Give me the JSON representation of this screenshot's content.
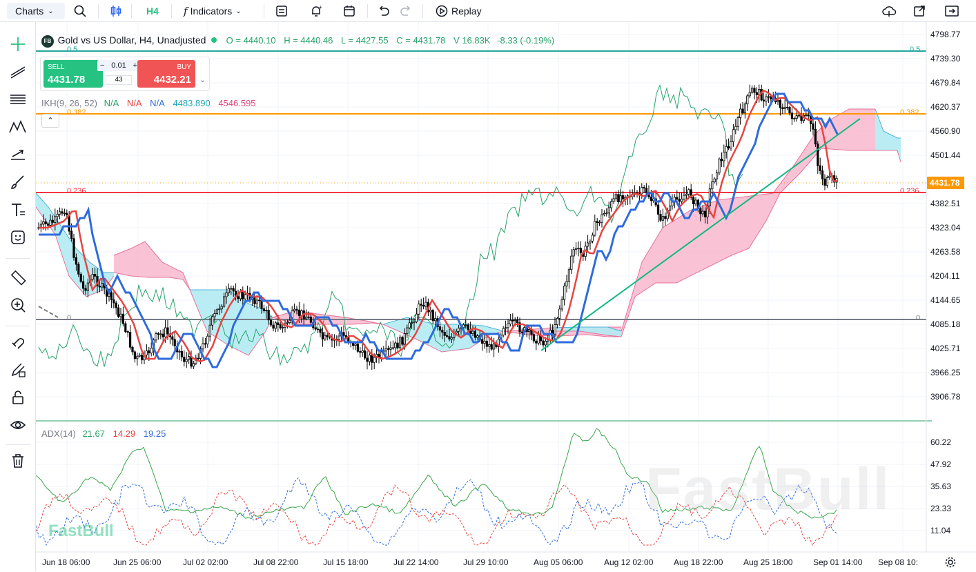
{
  "toolbar": {
    "charts_label": "Charts",
    "interval_label": "H4",
    "indicators_label": "Indicators",
    "replay_label": "Replay"
  },
  "legend": {
    "symbol_badge": "FB",
    "symbol": "Gold vs US Dollar, H4, Unadjusted",
    "open": "O = 4440.10",
    "high": "H = 4440.46",
    "low": "L = 4427.55",
    "close": "C = 4431.78",
    "volume": "V 16.83K",
    "change": "-8.33 (-0.19%)"
  },
  "trade_panel": {
    "sell_label": "SELL",
    "sell_price": "4431.78",
    "buy_label": "BUY",
    "buy_price": "4432.21",
    "lot_size": "0.01",
    "spread": "43"
  },
  "ichimoku": {
    "name": "IKH(9, 26, 52)",
    "v1": "N/A",
    "v2": "N/A",
    "v3": "N/A",
    "v4": "4483.890",
    "v5": "4546.595"
  },
  "adx": {
    "name": "ADX(14)",
    "adx": "21.67",
    "minus_di": "14.29",
    "plus_di": "19.25"
  },
  "fib_levels": {
    "l05": "0.5",
    "l0382": "0.382",
    "l0236": "0.236",
    "l0": "0"
  },
  "price_axis": [
    "4798.77",
    "4739.30",
    "4679.84",
    "4620.37",
    "4560.90",
    "4501.44",
    "4382.51",
    "4323.04",
    "4263.58",
    "4204.11",
    "4144.65",
    "4085.18",
    "4025.71",
    "3966.25",
    "3906.78"
  ],
  "current_price": "4431.78",
  "adx_axis": [
    "60.22",
    "47.92",
    "35.63",
    "23.33",
    "11.04"
  ],
  "time_axis": [
    "Jun 18 06:00",
    "Jun 25 06:00",
    "Jul 02 02:00",
    "Jul 08 22:00",
    "Jul 15 18:00",
    "Jul 22 14:00",
    "Jul 29 10:00",
    "Aug 05 06:00",
    "Aug 12 02:00",
    "Aug 18 22:00",
    "Aug 25 18:00",
    "Sep 01 14:00",
    "Sep 08 10:"
  ],
  "watermark": "FastBull",
  "colors": {
    "up": "#26c281",
    "down": "#f05454",
    "accent": "#2962ff",
    "fib05": "#26a69a",
    "fib0382": "#ff9800",
    "fib0236": "#f23645",
    "fib0": "#787b86",
    "price_tag": "#ff9800"
  }
}
